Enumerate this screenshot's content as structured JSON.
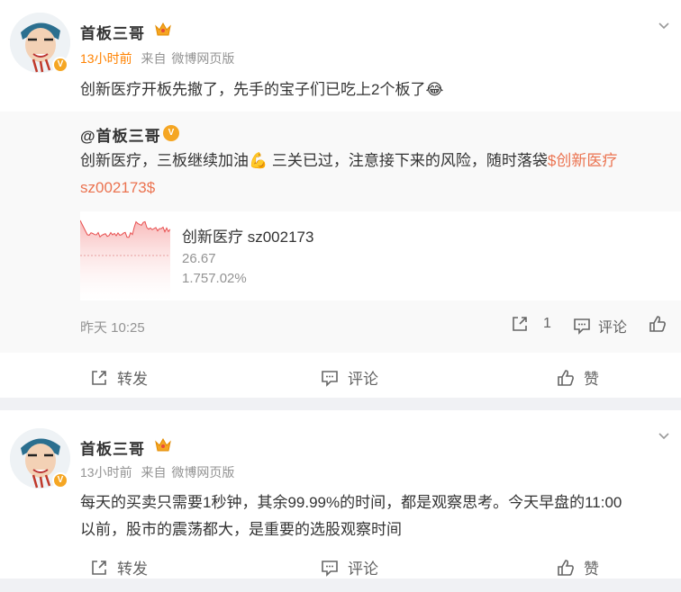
{
  "post1": {
    "author": "首板三哥",
    "time": "13小时前",
    "source_prefix": "来自",
    "source": "微博网页版",
    "text": "创新医疗开板先撤了，先手的宝子们已吃上2个板了",
    "emoji": "😂",
    "quote": {
      "author": "@首板三哥",
      "text_part1": "创新医疗，三板继续加油",
      "emoji": "💪",
      "text_part2": " 三关已过，注意接下来的风险，随时落袋",
      "link": "$创新医疗 sz002173$",
      "stock": {
        "name": "创新医疗 sz002173",
        "price": "26.67",
        "change": "1.757.02%"
      },
      "date": "昨天 10:25",
      "repost_count": "1",
      "comment_label": "评论"
    },
    "actions": {
      "repost": "转发",
      "comment": "评论",
      "like": "赞"
    }
  },
  "post2": {
    "author": "首板三哥",
    "time": "13小时前",
    "source_prefix": "来自",
    "source": "微博网页版",
    "text_line1": "每天的买卖只需要1秒钟，其余99.99%的时间，都是观察思考。今天早盘的11:00",
    "text_line2": "以前，股市的震荡都大，是重要的选股观察时间",
    "actions": {
      "repost": "转发",
      "comment": "评论",
      "like": "赞"
    }
  },
  "colors": {
    "accent": "#ff8200",
    "link": "#eb7350",
    "badge": "#f5a623"
  }
}
